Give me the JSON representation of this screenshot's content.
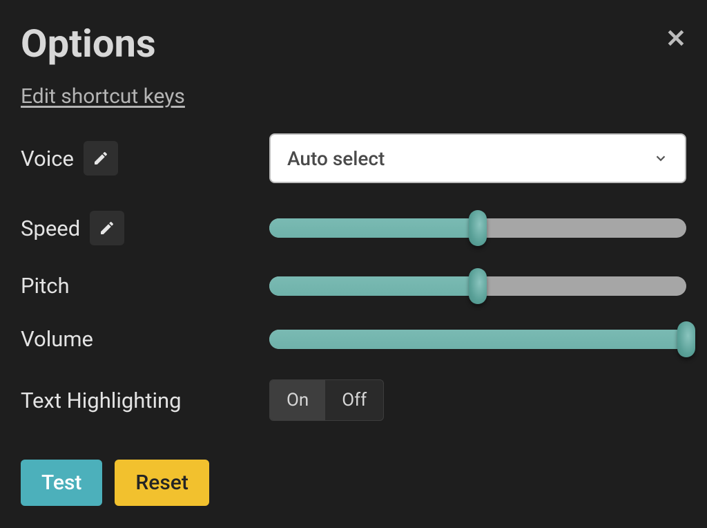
{
  "title": "Options",
  "shortcut_link": "Edit shortcut keys",
  "close_symbol": "✕",
  "rows": {
    "voice": {
      "label": "Voice",
      "select_value": "Auto select"
    },
    "speed": {
      "label": "Speed",
      "value_percent": 50
    },
    "pitch": {
      "label": "Pitch",
      "value_percent": 50
    },
    "volume": {
      "label": "Volume",
      "value_percent": 100
    },
    "highlighting": {
      "label": "Text Highlighting",
      "on": "On",
      "off": "Off",
      "active": "on"
    }
  },
  "buttons": {
    "test": "Test",
    "reset": "Reset"
  },
  "colors": {
    "accent": "#4cb0bb",
    "slider": "#6fb2aa",
    "reset": "#f2c12e"
  }
}
